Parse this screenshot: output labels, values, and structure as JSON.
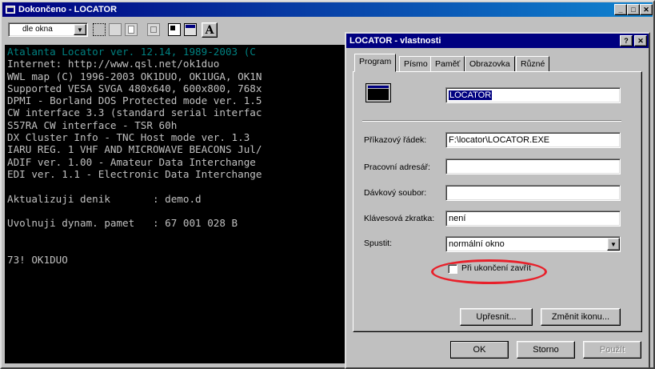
{
  "main_window": {
    "title": "Dokončeno - LOCATOR",
    "caption_buttons": [
      "_",
      "□",
      "X"
    ]
  },
  "toolbar": {
    "window_size_value": "dle okna",
    "font_button": "A"
  },
  "console_lines": [
    "Atalanta Locator ver. 12.14, 1989-2003 (C",
    "Internet: http://www.qsl.net/ok1duo",
    "WWL map (C) 1996-2003 OK1DUO, OK1UGA, OK1N",
    "Supported VESA SVGA 480x640, 600x800, 768x",
    "DPMI - Borland DOS Protected mode ver. 1.5",
    "CW interface 3.3 (standard serial interfac",
    "S57RA CW interface - TSR 60h",
    "DX Cluster Info - TNC Host mode ver. 1.3",
    "IARU REG. 1 VHF AND MICROWAVE BEACONS Jul/",
    "ADIF ver. 1.00 - Amateur Data Interchange",
    "EDI ver. 1.1 - Electronic Data Interchange",
    "",
    "Aktualizuji denik       : demo.d",
    "",
    "Uvolnuji dynam. pamet   : 67 001 028 B",
    "",
    "",
    "73! OK1DUO"
  ],
  "dialog": {
    "title": "LOCATOR - vlastnosti",
    "help_button": "?",
    "close_button": "X",
    "tabs": [
      "Program",
      "Písmo",
      "Paměť",
      "Obrazovka",
      "Různé"
    ],
    "program_name": "LOCATOR",
    "fields": {
      "command_line": {
        "label": "Příkazový řádek:",
        "value": "F:\\locator\\LOCATOR.EXE"
      },
      "working_dir": {
        "label": "Pracovní adresář:",
        "value": ""
      },
      "batch_file": {
        "label": "Dávkový soubor:",
        "value": ""
      },
      "shortcut": {
        "label": "Klávesová zkratka:",
        "value": "není"
      },
      "run": {
        "label": "Spustit:",
        "value": "normální okno"
      }
    },
    "close_on_exit_label": "Při ukončení zavřít",
    "close_on_exit_checked": false,
    "advanced_button": "Upřesnit...",
    "change_icon_button": "Změnit ikonu...",
    "ok_button": "OK",
    "cancel_button": "Storno",
    "apply_button": "Použít"
  },
  "colors": {
    "title_active": "#000080",
    "title_gradient": "#1084d0",
    "highlight_circle": "#e8202a",
    "console_bg": "#000000",
    "console_text": "#c0c0c0",
    "console_first_line": "#008080"
  }
}
